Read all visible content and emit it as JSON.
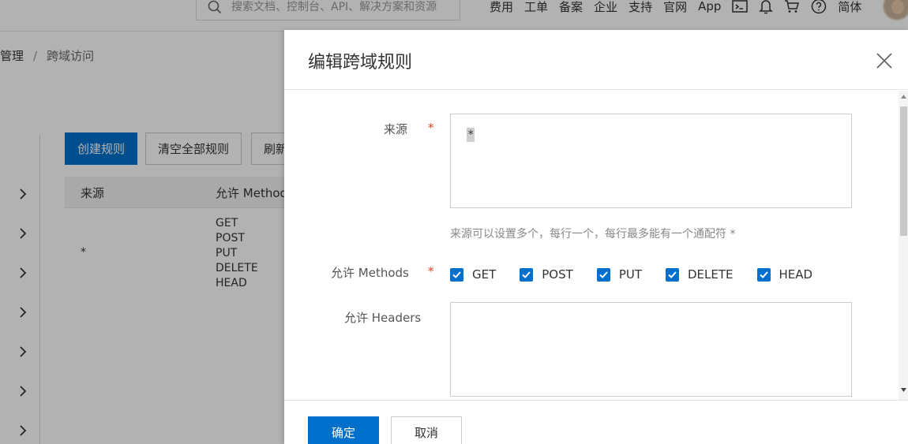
{
  "topbar": {
    "search_placeholder": "搜索文档、控制台、API、解决方案和资源",
    "nav": [
      "费用",
      "工单",
      "备案",
      "企业",
      "支持",
      "官网",
      "App"
    ],
    "language": "简体"
  },
  "breadcrumb": {
    "parent": "管理",
    "separator": "/",
    "current": "跨域访问"
  },
  "toolbar": {
    "create": "创建规则",
    "clear_all": "清空全部规则",
    "refresh": "刷新"
  },
  "table": {
    "columns": [
      "来源",
      "允许 Methods"
    ],
    "rows": [
      {
        "origin": "*",
        "methods": [
          "GET",
          "POST",
          "PUT",
          "DELETE",
          "HEAD"
        ]
      }
    ]
  },
  "drawer": {
    "title": "编辑跨域规则",
    "origin_label": "来源",
    "origin_value": "*",
    "origin_hint": "来源可以设置多个，每行一个，每行最多能有一个通配符 *",
    "methods_label": "允许 Methods",
    "methods": [
      {
        "label": "GET",
        "checked": true
      },
      {
        "label": "POST",
        "checked": true
      },
      {
        "label": "PUT",
        "checked": true
      },
      {
        "label": "DELETE",
        "checked": true
      },
      {
        "label": "HEAD",
        "checked": true
      }
    ],
    "headers_label": "允许 Headers",
    "headers_value": "",
    "required_mark": "*",
    "ok": "确定",
    "cancel": "取消"
  },
  "colors": {
    "primary": "#0070cc",
    "required": "#e0401c",
    "mask": "rgba(0,0,0,0.3)"
  }
}
